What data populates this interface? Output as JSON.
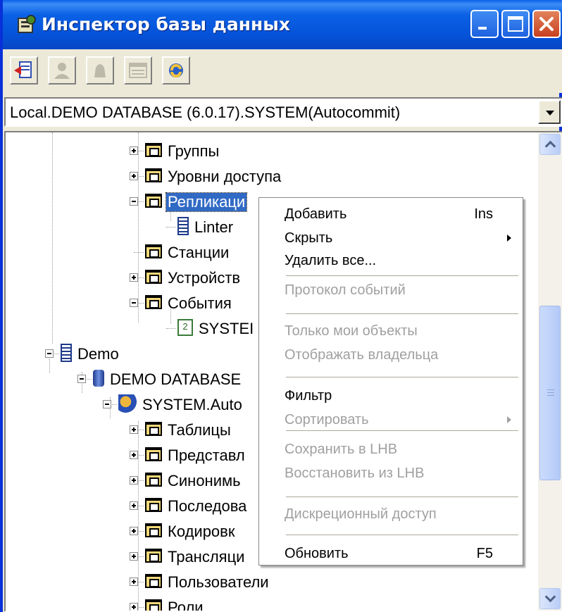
{
  "window": {
    "title": "Инспектор базы данных",
    "title_icon": "db-inspector-icon",
    "controls": [
      "minimize-icon",
      "maximize-icon",
      "close-icon"
    ]
  },
  "toolbar": {
    "buttons": [
      {
        "icon": "add-connection-icon",
        "enabled": true
      },
      {
        "icon": "user-icon",
        "enabled": false
      },
      {
        "icon": "bell-icon",
        "enabled": false
      },
      {
        "icon": "window-icon",
        "enabled": false
      },
      {
        "icon": "refresh-icon",
        "enabled": true
      }
    ]
  },
  "connection_combo": {
    "value": "Local.DEMO DATABASE (6.0.17).SYSTEM(Autocommit)"
  },
  "tree": {
    "items": [
      {
        "label": "Группы",
        "icon": "folder-icon"
      },
      {
        "label": "Уровни доступа",
        "icon": "folder-icon"
      },
      {
        "label": "Репликаци",
        "icon": "folder-icon",
        "selected": true
      },
      {
        "label": "Linter",
        "icon": "database-icon"
      },
      {
        "label": "Станции",
        "icon": "folder-icon"
      },
      {
        "label": "Устройств",
        "icon": "folder-icon"
      },
      {
        "label": "События",
        "icon": "folder-icon"
      },
      {
        "label": "SYSTEI",
        "icon": "calendar-icon"
      },
      {
        "label": "Demo",
        "icon": "database-icon"
      },
      {
        "label": "DEMO DATABASE",
        "icon": "cylinder-icon"
      },
      {
        "label": "SYSTEM.Auto",
        "icon": "connection-icon"
      },
      {
        "label": "Таблицы",
        "icon": "folder-icon"
      },
      {
        "label": "Представл",
        "icon": "folder-icon"
      },
      {
        "label": "Синонимь",
        "icon": "folder-icon"
      },
      {
        "label": "Последова",
        "icon": "folder-icon"
      },
      {
        "label": "Кодировк",
        "icon": "folder-icon"
      },
      {
        "label": "Трансляци",
        "icon": "folder-icon"
      },
      {
        "label": "Пользователи",
        "icon": "folder-icon"
      },
      {
        "label": "Роли",
        "icon": "folder-icon"
      }
    ]
  },
  "context_menu": {
    "items": [
      {
        "label": "Добавить",
        "shortcut": "Ins",
        "disabled": false
      },
      {
        "label": "Скрыть",
        "submenu": true,
        "disabled": false
      },
      {
        "label": "Удалить все...",
        "disabled": false
      },
      {
        "label": "Протокол событий",
        "disabled": true
      },
      {
        "label": "Только мои объекты",
        "disabled": true
      },
      {
        "label": "Отображать владельца",
        "disabled": true
      },
      {
        "label": "Фильтр",
        "disabled": false
      },
      {
        "label": "Сортировать",
        "submenu": true,
        "disabled": true
      },
      {
        "label": "Сохранить в LHB",
        "disabled": true
      },
      {
        "label": "Восстановить из LHB",
        "disabled": true
      },
      {
        "label": "Дискреционный доступ",
        "disabled": true
      },
      {
        "label": "Обновить",
        "shortcut": "F5",
        "disabled": false
      }
    ]
  },
  "colors": {
    "titlebar": "#0553d9",
    "selection": "#316ac5",
    "disabled_text": "#a0a0a0"
  }
}
